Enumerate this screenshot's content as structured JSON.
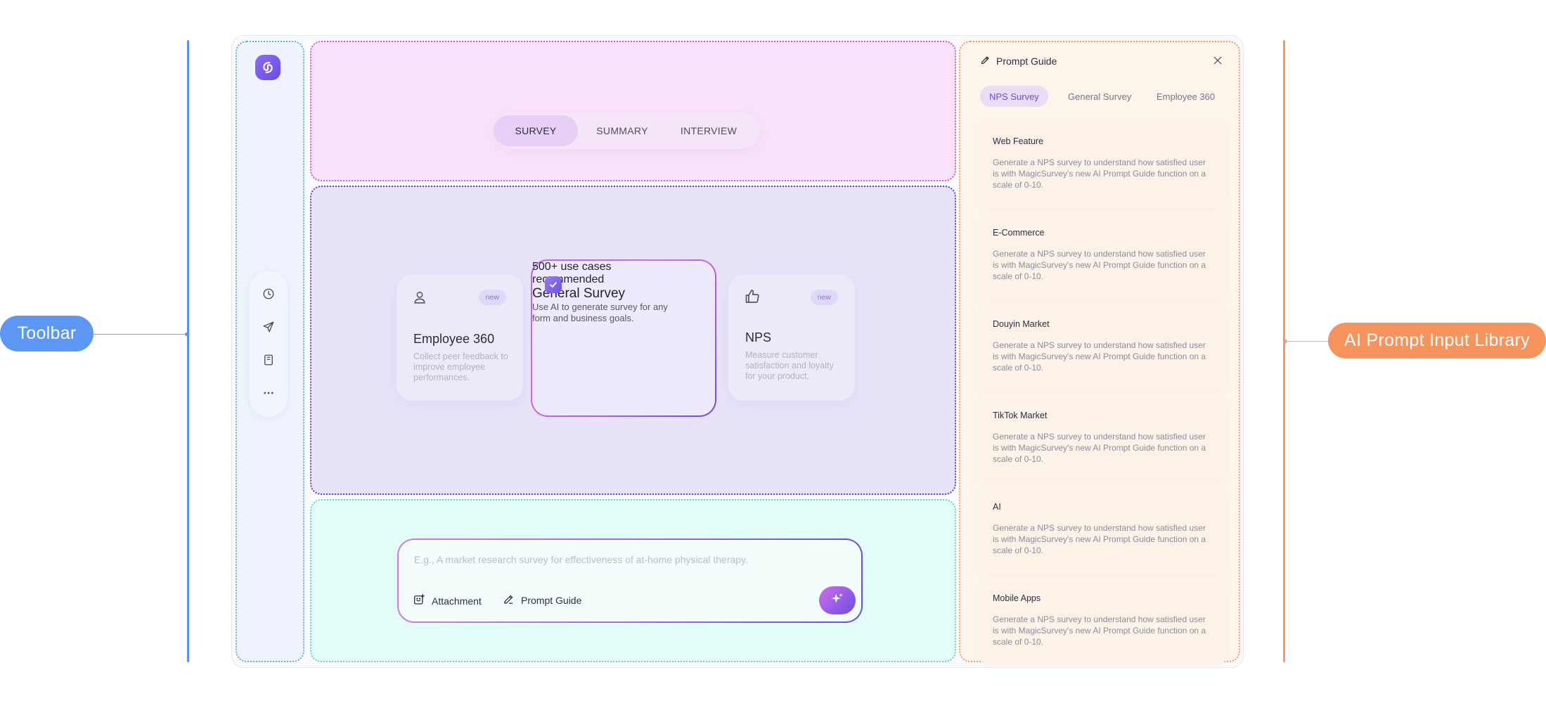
{
  "annotations": {
    "toolbar_label": "Toolbar",
    "library_label": "AI Prompt Input Library",
    "toolbar_color": "#5d97f5",
    "library_color": "#f7935d"
  },
  "sidebar": {
    "logo_icon": "brand-logo-icon",
    "tools": [
      {
        "name": "history",
        "icon": "clock-icon"
      },
      {
        "name": "send",
        "icon": "send-icon"
      },
      {
        "name": "notebook",
        "icon": "notebook-icon"
      },
      {
        "name": "more",
        "icon": "more-icon"
      }
    ]
  },
  "mode_tabs": [
    {
      "label": "SURVEY",
      "active": true
    },
    {
      "label": "SUMMARY",
      "active": false
    },
    {
      "label": "INTERVIEW",
      "active": false
    }
  ],
  "mode_cards": {
    "employee": {
      "title": "Employee 360",
      "badge": "new",
      "description": "Collect peer feedback to improve employee performances.",
      "icon": "user-icon"
    },
    "general": {
      "title": "General Survey",
      "badges": [
        "500+ use cases",
        "recommended"
      ],
      "description": "Use AI to generate survey for any form and business goals.",
      "icon": "check-icon",
      "selected": true
    },
    "nps": {
      "title": "NPS",
      "badge": "new",
      "description": "Measure customer satisfaction and loyalty for your product.",
      "icon": "thumbs-up-icon"
    }
  },
  "prompt_input": {
    "placeholder": "E.g., A market research survey for effectiveness of at-home physical therapy.",
    "attachment_label": "Attachment",
    "prompt_guide_label": "Prompt Guide",
    "send_icon": "sparkle-icon"
  },
  "guide_panel": {
    "title": "Prompt Guide",
    "tabs": [
      {
        "label": "NPS Survey",
        "active": true
      },
      {
        "label": "General Survey",
        "active": false
      },
      {
        "label": "Employee 360",
        "active": false
      }
    ],
    "items": [
      {
        "title": "Web Feature",
        "description": "Generate a NPS survey to understand how satisfied user is with MagicSurvey's new AI Prompt Guide function on a scale of 0-10."
      },
      {
        "title": "E-Commerce",
        "description": "Generate a NPS survey to understand how satisfied user is with MagicSurvey's new AI Prompt Guide function on a scale of 0-10."
      },
      {
        "title": "Douyin Market",
        "description": "Generate a NPS survey to understand how satisfied user is with MagicSurvey's new AI Prompt Guide function on a scale of 0-10."
      },
      {
        "title": "TikTok Market",
        "description": "Generate a NPS survey to understand how satisfied user is with MagicSurvey's new AI Prompt Guide function on a scale of 0-10."
      },
      {
        "title": "AI",
        "description": "Generate a NPS survey to understand how satisfied user is with MagicSurvey's new AI Prompt Guide function on a scale of 0-10."
      },
      {
        "title": "Mobile Apps",
        "description": "Generate a NPS survey to understand how satisfied user is with MagicSurvey's new AI Prompt Guide function on a scale of 0-10."
      }
    ]
  }
}
